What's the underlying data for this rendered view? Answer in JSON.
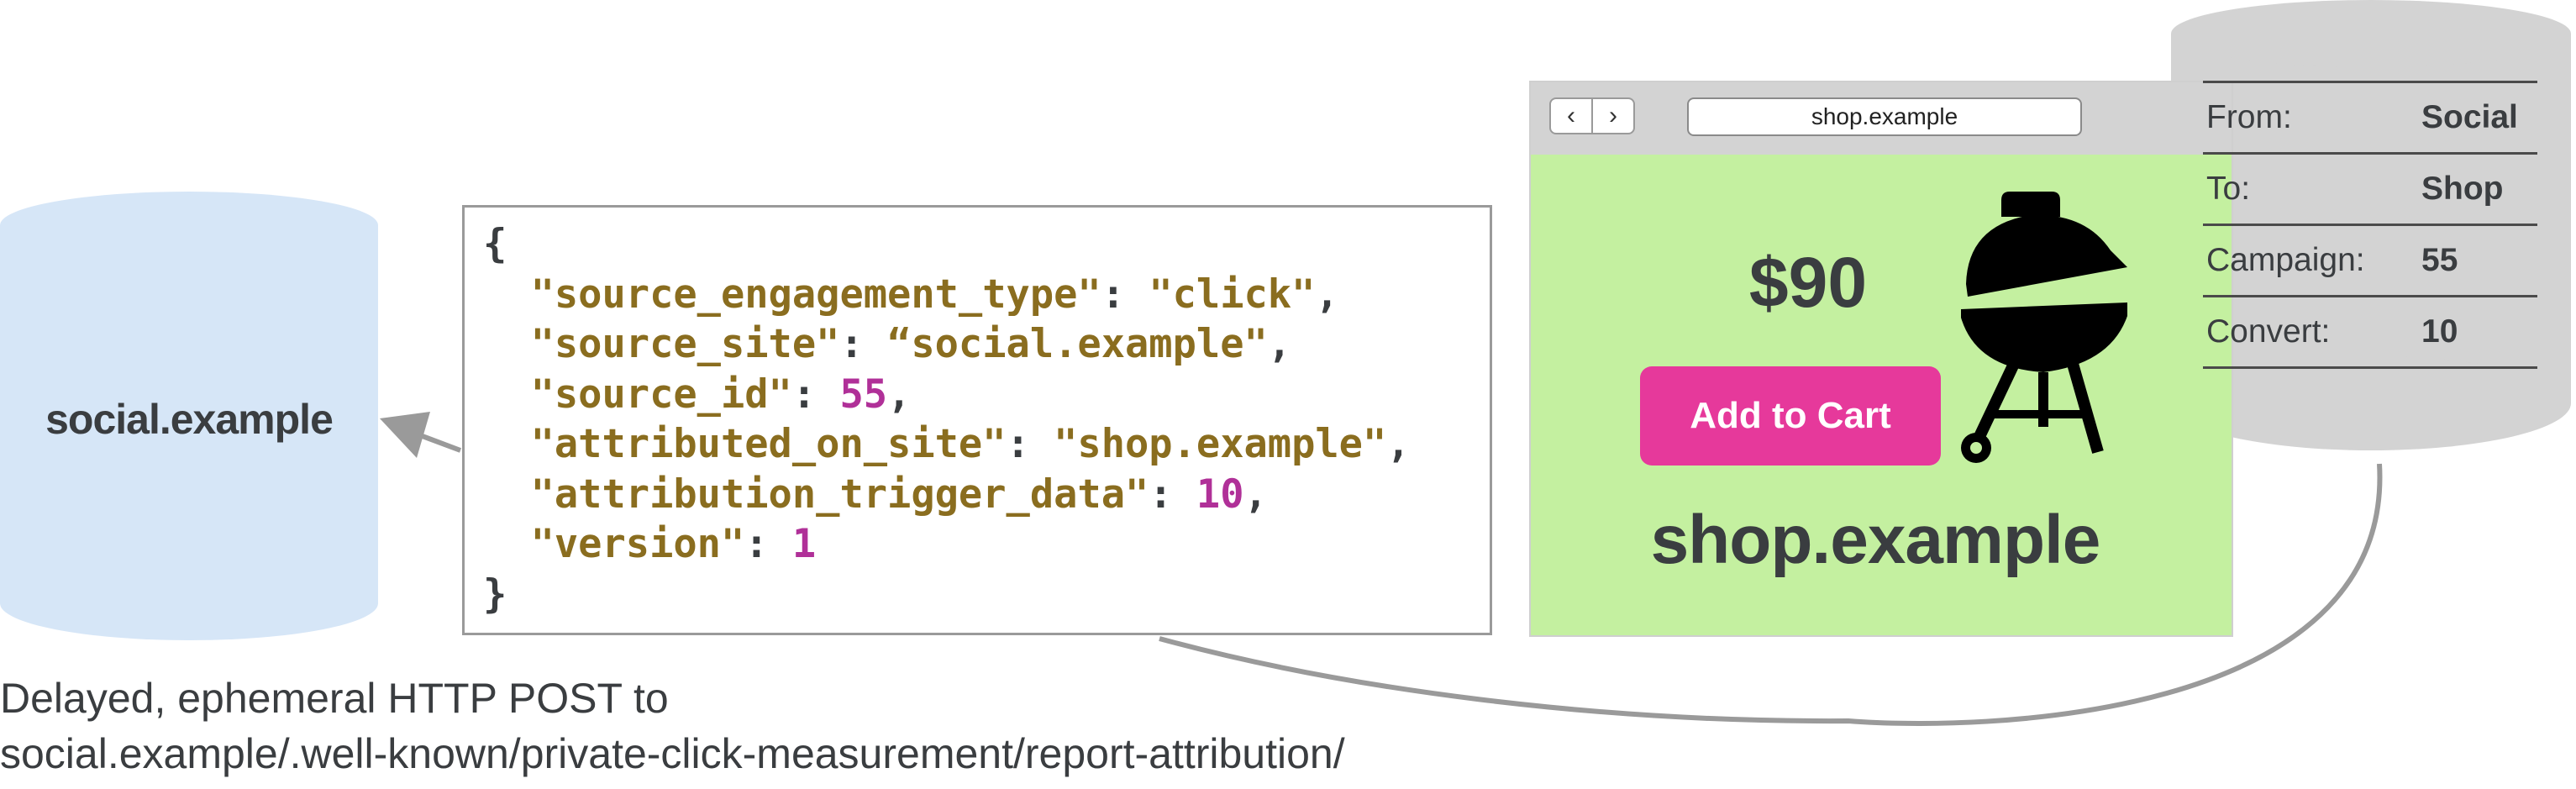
{
  "source_db": {
    "label": "social.example",
    "fill_color": "#d6e6f7"
  },
  "report_json": {
    "lines": [
      [
        {
          "t": "{",
          "c": "p"
        }
      ],
      [
        {
          "t": "  \"source_engagement_type\"",
          "c": "k"
        },
        {
          "t": ": ",
          "c": "p"
        },
        {
          "t": "\"click\"",
          "c": "s"
        },
        {
          "t": ",",
          "c": "p"
        }
      ],
      [
        {
          "t": "  \"source_site\"",
          "c": "k"
        },
        {
          "t": ": ",
          "c": "p"
        },
        {
          "t": "“social.example\"",
          "c": "s"
        },
        {
          "t": ",",
          "c": "p"
        }
      ],
      [
        {
          "t": "  \"source_id\"",
          "c": "k"
        },
        {
          "t": ": ",
          "c": "p"
        },
        {
          "t": "55",
          "c": "n"
        },
        {
          "t": ",",
          "c": "p"
        }
      ],
      [
        {
          "t": "  \"attributed_on_site\"",
          "c": "k"
        },
        {
          "t": ": ",
          "c": "p"
        },
        {
          "t": "\"shop.example\"",
          "c": "s"
        },
        {
          "t": ",",
          "c": "p"
        }
      ],
      [
        {
          "t": "  \"attribution_trigger_data\"",
          "c": "k"
        },
        {
          "t": ": ",
          "c": "p"
        },
        {
          "t": "10",
          "c": "n"
        },
        {
          "t": ",",
          "c": "p"
        }
      ],
      [
        {
          "t": "  \"version\"",
          "c": "k"
        },
        {
          "t": ": ",
          "c": "p"
        },
        {
          "t": "1",
          "c": "n"
        }
      ],
      [
        {
          "t": "}",
          "c": "p"
        }
      ]
    ]
  },
  "browser": {
    "back_label": "‹",
    "forward_label": "›",
    "address": "shop.example",
    "price": "$90",
    "add_to_cart_label": "Add to Cart",
    "site_name": "shop.example",
    "page_color": "#c4f0a0",
    "button_color": "#e6399b"
  },
  "attribution_store": {
    "fill_color": "#d3d3d3",
    "rows": [
      {
        "key": "From:",
        "value": "Social"
      },
      {
        "key": "To:",
        "value": "Shop"
      },
      {
        "key": "Campaign:",
        "value": "55"
      },
      {
        "key": "Convert:",
        "value": "10"
      }
    ]
  },
  "caption": {
    "line1": "Delayed, ephemeral HTTP POST to",
    "line2": "social.example/.well-known/private-click-measurement/report-attribution/"
  },
  "icons": [
    "left-arrow-icon",
    "grill-icon"
  ]
}
